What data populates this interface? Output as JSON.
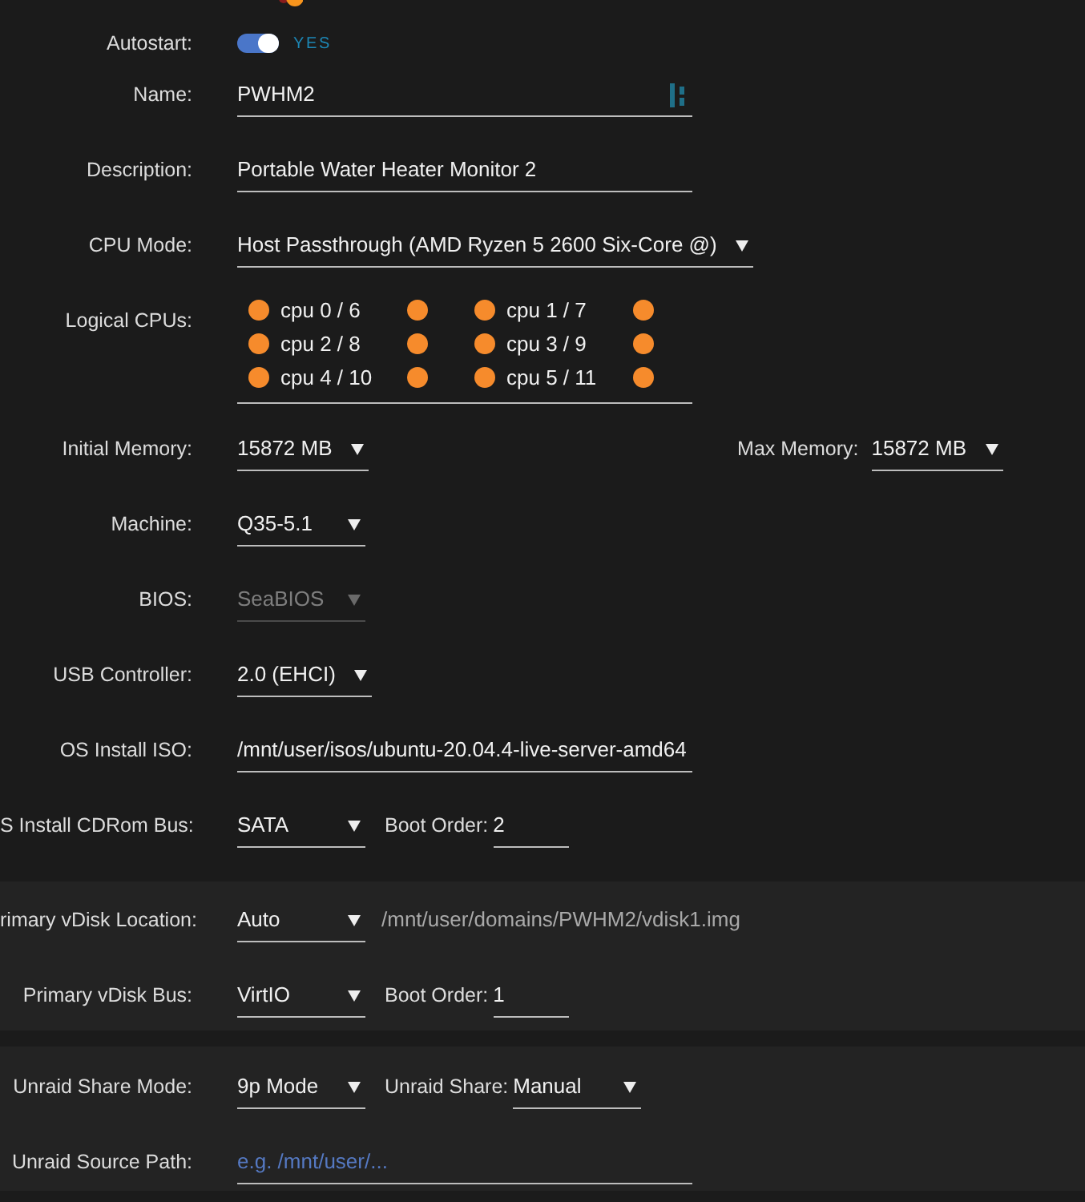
{
  "sections": [
    {
      "rows": [
        {
          "kind": "toggle",
          "label": "Autostart:",
          "on": true,
          "text": "YES"
        },
        {
          "kind": "input",
          "label": "Name:",
          "value": "PWHM2",
          "trailing_icon": true
        },
        {
          "kind": "input",
          "label": "Description:",
          "value": "Portable Water Heater Monitor 2"
        },
        {
          "kind": "select",
          "label": "CPU Mode:",
          "value": "Host Passthrough (AMD Ryzen 5 2600 Six-Core @)",
          "disabled": false
        },
        {
          "kind": "cpus",
          "label": "Logical CPUs:",
          "cpus": [
            {
              "label": "cpu 0 / 6",
              "checked": true,
              "sibling_checked": true
            },
            {
              "label": "cpu 1 / 7",
              "checked": true,
              "sibling_checked": true
            },
            {
              "label": "cpu 2 / 8",
              "checked": true,
              "sibling_checked": true
            },
            {
              "label": "cpu 3 / 9",
              "checked": true,
              "sibling_checked": true
            },
            {
              "label": "cpu 4 / 10",
              "checked": true,
              "sibling_checked": true
            },
            {
              "label": "cpu 5 / 11",
              "checked": true,
              "sibling_checked": true
            }
          ]
        },
        {
          "kind": "select",
          "label": "Initial Memory:",
          "value": "15872 MB",
          "disabled": false,
          "extras": [
            {
              "kind": "column_select",
              "label": "Max Memory:",
              "value": "15872 MB",
              "disabled": false
            }
          ]
        },
        {
          "kind": "select",
          "label": "Machine:",
          "value": "Q35-5.1",
          "disabled": false
        },
        {
          "kind": "select",
          "label": "BIOS:",
          "value": "SeaBIOS",
          "disabled": true
        },
        {
          "kind": "select",
          "label": "USB Controller:",
          "value": "2.0 (EHCI)",
          "disabled": false
        },
        {
          "kind": "input",
          "label": "OS Install ISO:",
          "value": "/mnt/user/isos/ubuntu-20.04.4-live-server-amd64"
        },
        {
          "kind": "select",
          "label": "S Install CDRom Bus:",
          "value": "SATA",
          "disabled": false,
          "extras": [
            {
              "kind": "input",
              "label": "Boot Order:",
              "value": "2"
            }
          ]
        }
      ]
    },
    {
      "rows": [
        {
          "kind": "select",
          "label": "rimary vDisk Location:",
          "value": "Auto",
          "disabled": false,
          "extras": [
            {
              "kind": "note",
              "text": "/mnt/user/domains/PWHM2/vdisk1.img"
            }
          ]
        },
        {
          "kind": "select",
          "label": "Primary vDisk Bus:",
          "value": "VirtIO",
          "disabled": false,
          "extras": [
            {
              "kind": "input",
              "label": "Boot Order:",
              "value": "1"
            }
          ]
        }
      ]
    },
    {
      "rows": [
        {
          "kind": "select",
          "label": "Unraid Share Mode:",
          "value": "9p Mode",
          "disabled": false,
          "extras": [
            {
              "kind": "select",
              "label": "Unraid Share:",
              "value": "Manual",
              "disabled": false
            }
          ]
        },
        {
          "kind": "input",
          "label": "Unraid Source Path:",
          "placeholder": "e.g. /mnt/user/..."
        }
      ]
    }
  ]
}
